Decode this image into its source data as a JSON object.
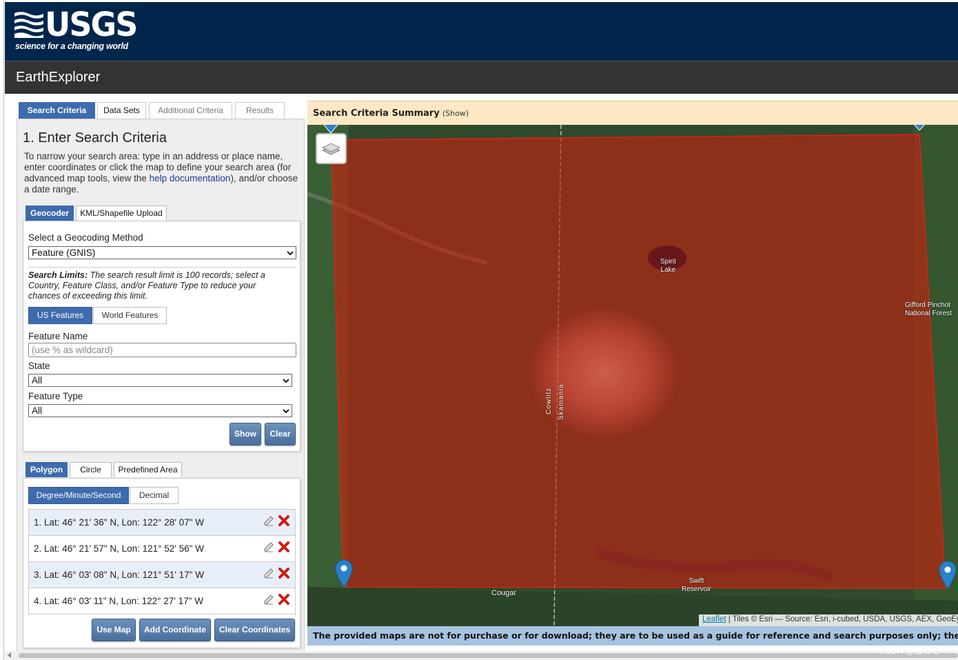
{
  "brand": {
    "logo_text": "USGS",
    "tagline": "science for a changing world",
    "app_title": "EarthExplorer"
  },
  "main_tabs": [
    {
      "label": "Search Criteria",
      "active": true
    },
    {
      "label": "Data Sets",
      "active": false
    },
    {
      "label": "Additional Criteria",
      "active": false
    },
    {
      "label": "Results",
      "active": false
    }
  ],
  "search": {
    "section_title": "1. Enter Search Criteria",
    "intro_before_link": "To narrow your search area: type in an address or place name, enter coordinates or click the map to define your search area (for advanced map tools, view the ",
    "help_link": "help documentation",
    "intro_after_link": "), and/or choose a date range.",
    "subtabs": [
      {
        "label": "Geocoder",
        "active": true
      },
      {
        "label": "KML/Shapefile Upload",
        "active": false
      }
    ],
    "geocoder": {
      "method_label": "Select a Geocoding Method",
      "method_value": "Feature (GNIS)",
      "limits_title": "Search Limits:",
      "limits_text": " The search result limit is 100 records; select a Country, Feature Class, and/or Feature Type to reduce your chances of exceeding this limit.",
      "feature_toggles": [
        {
          "label": "US Features",
          "active": true
        },
        {
          "label": "World Features",
          "active": false
        }
      ],
      "feature_name_label": "Feature Name",
      "feature_name_placeholder": "(use % as wildcard)",
      "state_label": "State",
      "state_value": "All",
      "feature_type_label": "Feature Type",
      "feature_type_value": "All",
      "show_button": "Show",
      "clear_button": "Clear"
    }
  },
  "area": {
    "tabs": [
      {
        "label": "Polygon",
        "active": true
      },
      {
        "label": "Circle",
        "active": false
      },
      {
        "label": "Predefined Area",
        "active": false
      }
    ],
    "format_toggles": [
      {
        "label": "Degree/Minute/Second",
        "active": true
      },
      {
        "label": "Decimal",
        "active": false
      }
    ],
    "coordinates": [
      "1.  Lat: 46° 21' 36\" N, Lon: 122° 28' 07\" W",
      "2.  Lat: 46° 21' 57\" N, Lon: 121° 52' 56\" W",
      "3.  Lat: 46° 03' 08\" N, Lon: 121° 51' 17\" W",
      "4.  Lat: 46° 03' 11\" N, Lon: 122° 27' 17\" W"
    ],
    "buttons": {
      "use_map": "Use Map",
      "add_coordinate": "Add Coordinate",
      "clear_coordinates": "Clear Coordinates"
    }
  },
  "summary": {
    "title": "Search Criteria Summary",
    "show": "(Show)"
  },
  "map": {
    "labels": {
      "spirit_lake_1": "Spirit",
      "spirit_lake_2": "Lake",
      "gifford_1": "Gifford Pinchot",
      "gifford_2": "National Forest",
      "cowlitz": "Cowlitz",
      "skamania": "Skamania",
      "cougar": "Cougar",
      "swift_1": "Swift",
      "swift_2": "Reservoir"
    },
    "attribution_link": "Leaflet",
    "attribution_text": " | Tiles © Esri — Source: Esri, i-cubed, USDA, USGS, AEX, GeoEye, Getmapping, Aerogrid, IGN, IGP, UPR-EGP, and the GIS User Community",
    "polygon_color": "#c8200f",
    "marker_color": "#2a81cb"
  },
  "disclaimer": "The provided maps are not for purchase or for download; they are to be used as a guide for reference and search purposes only; they are not to be used for navigation.",
  "watermark": "CSDN @红杉心"
}
